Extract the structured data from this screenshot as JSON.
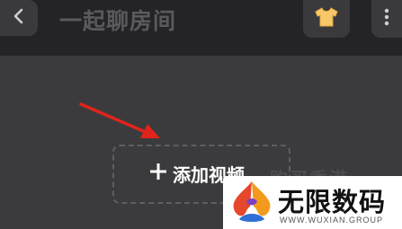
{
  "header": {
    "title": "一起聊房间",
    "back_icon": "chevron-left-icon",
    "outfit_icon": "shirt-icon",
    "more_icon": "more-vertical-icon"
  },
  "main": {
    "add_video_icon": "plus-icon",
    "add_video_label": "添加视频",
    "hint_text": "购买香港"
  },
  "annotation": {
    "arrow_icon": "red-arrow-icon",
    "arrow_color": "#e0241b"
  },
  "watermark": {
    "name_cn": "无限数码",
    "name_en": "WWW.WUXIAN.GROUP"
  },
  "colors": {
    "topbar_bg": "#242426",
    "page_bg": "#3b3b3d",
    "shirt_yellow": "#f7c86a"
  }
}
